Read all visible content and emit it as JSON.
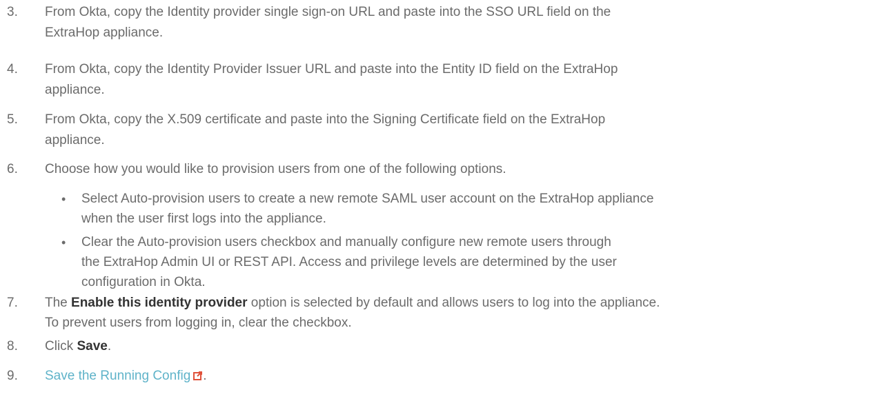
{
  "steps": [
    {
      "num": "3.",
      "line1": "From Okta, copy the Identity provider single sign-on URL and paste into the SSO URL field on the",
      "line2": "ExtraHop appliance."
    },
    {
      "num": "4.",
      "line1": "From Okta, copy the Identity Provider Issuer URL and paste into the Entity ID field on the ExtraHop",
      "line2": "appliance."
    },
    {
      "num": "5.",
      "line1": "From Okta, copy the X.509 certificate and paste into the Signing Certificate field on the ExtraHop",
      "line2": "appliance."
    },
    {
      "num": "6.",
      "line1": "Choose how you would like to provision users from one of the following options."
    },
    {
      "num": "7.",
      "pre": "The ",
      "bold": "Enable this identity provider",
      "post": " option is selected by default and allows users to log into the appliance.",
      "line2": "To prevent users from logging in, clear the checkbox."
    },
    {
      "num": "8.",
      "pre": "Click ",
      "bold": "Save",
      "post": "."
    },
    {
      "num": "9.",
      "link": "Save the Running Config",
      "post": "."
    }
  ],
  "bullets": [
    {
      "line1": "Select Auto-provision users to create a new remote SAML user account on the ExtraHop appliance",
      "line2": "when the user first logs into the appliance."
    },
    {
      "line1": "Clear the Auto-provision users checkbox and manually configure new remote users through",
      "line2": "the ExtraHop Admin UI or REST API. Access and privilege levels are determined by the user",
      "line3": "configuration in Okta."
    }
  ],
  "bullet_glyph": "•",
  "icons": {
    "external_link": "external-link-icon"
  },
  "colors": {
    "text": "#6b6b6b",
    "bold": "#333333",
    "link": "#5fb3c9"
  }
}
